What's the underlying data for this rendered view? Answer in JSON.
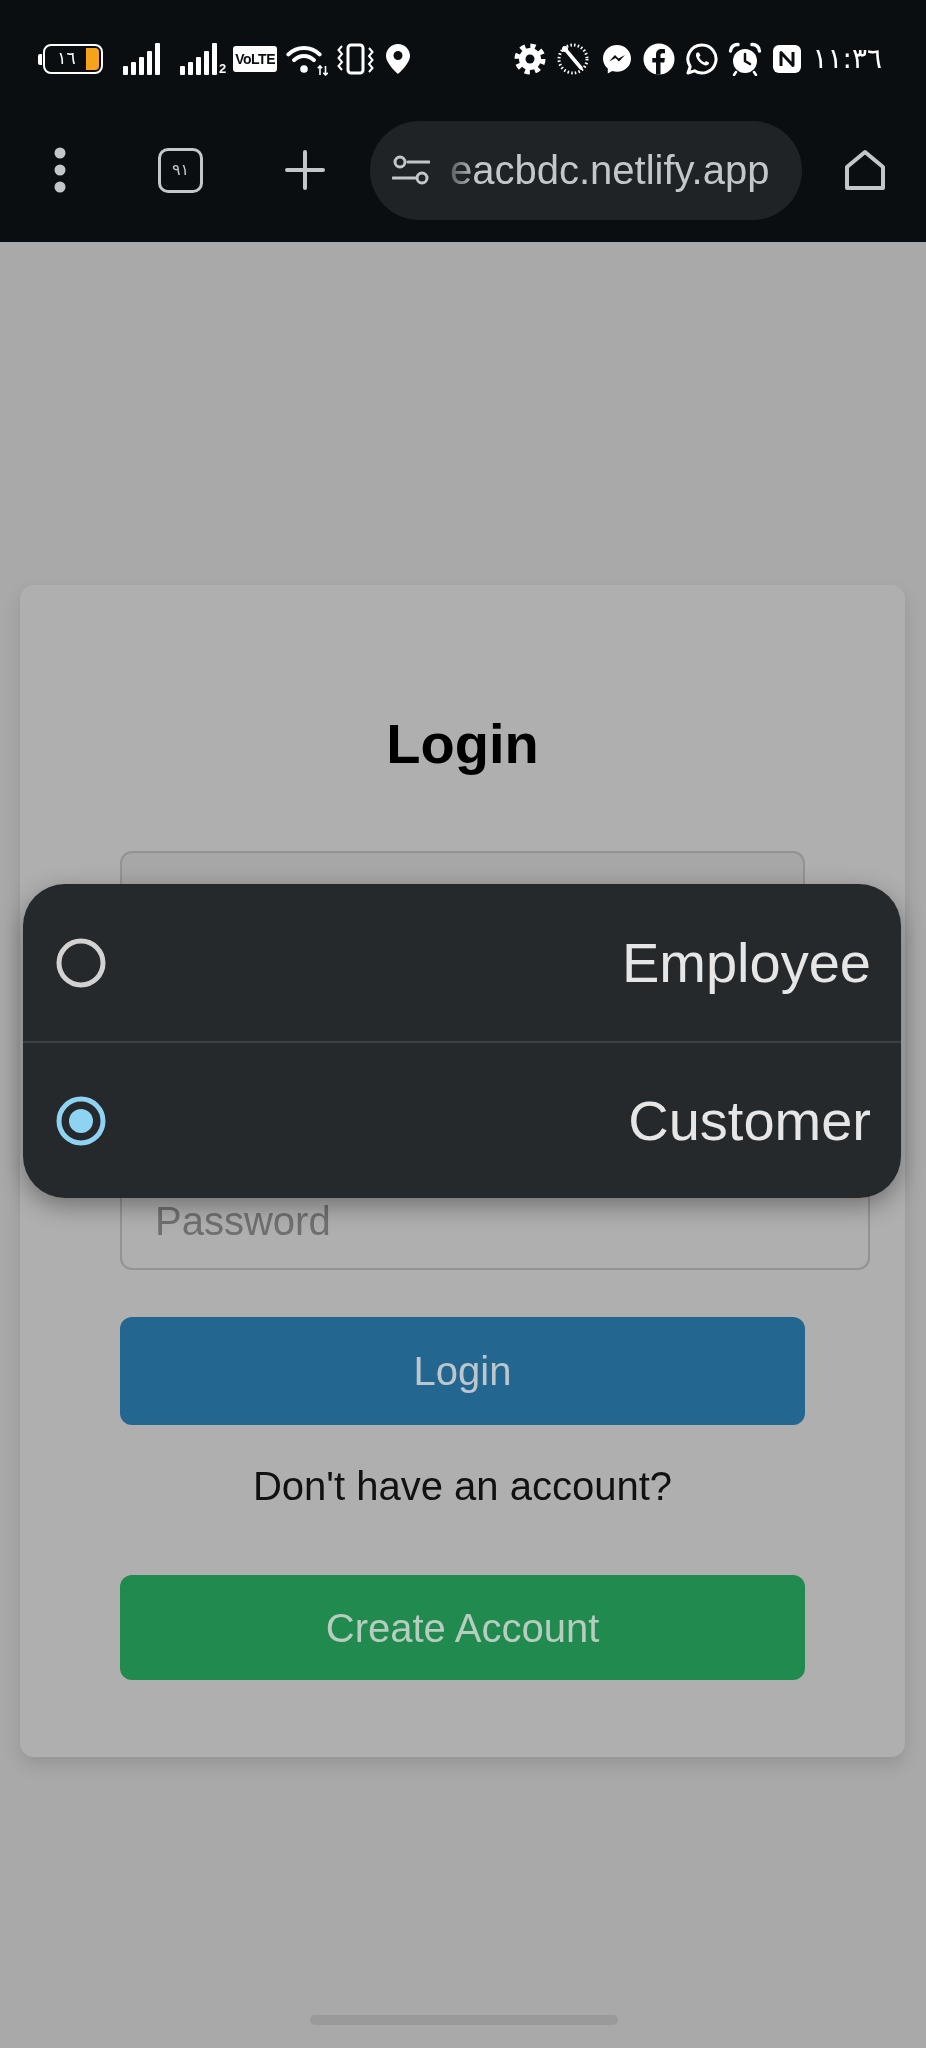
{
  "status_bar": {
    "battery": "١٦",
    "network_label": "VoLTE",
    "sim_number": "2",
    "time": "١١:٣٦"
  },
  "browser_toolbar": {
    "tab_count": "٩١",
    "url": "eacbdc.netlify.app"
  },
  "login_card": {
    "title": "Login",
    "password_field": {
      "placeholder": "Password"
    },
    "login_button": "Login",
    "signup_prompt": "Don't have an account?",
    "create_account_button": "Create Account"
  },
  "dropdown": {
    "options": [
      {
        "label": "Employee",
        "selected": false
      },
      {
        "label": "Customer",
        "selected": true
      }
    ]
  }
}
